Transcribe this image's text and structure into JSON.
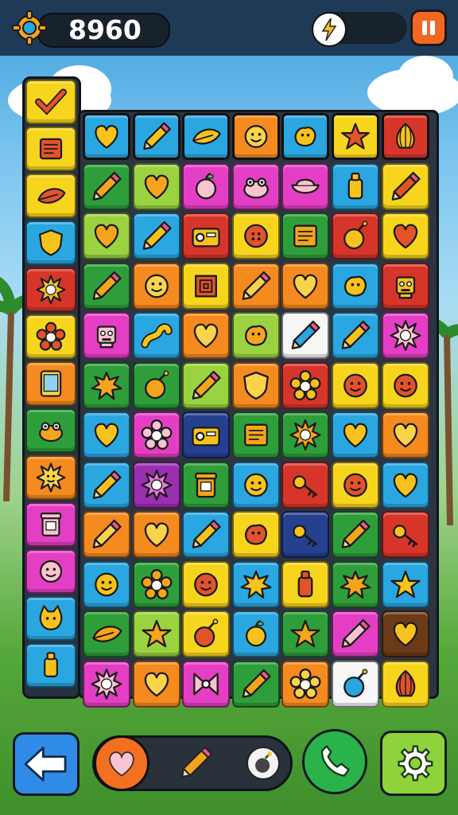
{
  "hud": {
    "score": "8960"
  },
  "colors": {
    "yellow": "#f7d51d",
    "orange": "#f58a1f",
    "green": "#2e9e3a",
    "lime": "#9ad33f",
    "blue": "#2aa6e0",
    "magenta": "#e43fc4",
    "red": "#d8352a",
    "purple": "#9b2fb0",
    "white": "#f7f7f7",
    "brown": "#6b3a18",
    "navy": "#25408f"
  },
  "side_column": {
    "tiles": [
      {
        "color": "yellow",
        "icon": "checkmark-icon"
      },
      {
        "color": "yellow",
        "icon": "note-icon"
      },
      {
        "color": "yellow",
        "icon": "leaf-icon"
      },
      {
        "color": "blue",
        "icon": "shield-icon"
      },
      {
        "color": "red",
        "icon": "sun-icon"
      },
      {
        "color": "yellow",
        "icon": "flower-icon"
      },
      {
        "color": "orange",
        "icon": "tablet-icon"
      },
      {
        "color": "green",
        "icon": "frog-icon"
      },
      {
        "color": "orange",
        "icon": "sun-face-icon"
      },
      {
        "color": "magenta",
        "icon": "jar-icon"
      },
      {
        "color": "magenta",
        "icon": "smiley-icon"
      },
      {
        "color": "blue",
        "icon": "cat-icon"
      },
      {
        "color": "blue",
        "icon": "bottle-icon"
      }
    ]
  },
  "board": {
    "featured_row": [
      {
        "color": "blue",
        "icon": "heart-icon"
      },
      {
        "color": "blue",
        "icon": "pencil-icon"
      },
      {
        "color": "blue",
        "icon": "leaf-icon"
      },
      {
        "color": "orange",
        "icon": "smiley-icon"
      },
      {
        "color": "blue",
        "icon": "blob-icon"
      },
      {
        "color": "yellow",
        "icon": "star-icon"
      },
      {
        "color": "red",
        "icon": "onion-icon"
      }
    ],
    "rows": [
      [
        {
          "color": "green",
          "icon": "pencil-icon"
        },
        {
          "color": "lime",
          "icon": "heart-icon"
        },
        {
          "color": "magenta",
          "icon": "apple-icon"
        },
        {
          "color": "magenta",
          "icon": "frog-icon"
        },
        {
          "color": "magenta",
          "icon": "bowl-icon"
        },
        {
          "color": "blue",
          "icon": "bottle-icon"
        },
        {
          "color": "yellow",
          "icon": "pencil-icon"
        }
      ],
      [
        {
          "color": "lime",
          "icon": "heart-icon"
        },
        {
          "color": "blue",
          "icon": "pencil-icon"
        },
        {
          "color": "red",
          "icon": "radio-icon"
        },
        {
          "color": "yellow",
          "icon": "button-icon"
        },
        {
          "color": "green",
          "icon": "note-icon"
        },
        {
          "color": "red",
          "icon": "bomb-icon"
        },
        {
          "color": "yellow",
          "icon": "heart-icon"
        }
      ],
      [
        {
          "color": "green",
          "icon": "pencil-icon"
        },
        {
          "color": "orange",
          "icon": "smiley-icon"
        },
        {
          "color": "yellow",
          "icon": "box-icon"
        },
        {
          "color": "orange",
          "icon": "pencil-icon"
        },
        {
          "color": "orange",
          "icon": "heart-icon"
        },
        {
          "color": "blue",
          "icon": "blob-icon"
        },
        {
          "color": "red",
          "icon": "robot-icon"
        }
      ],
      [
        {
          "color": "magenta",
          "icon": "robot-icon"
        },
        {
          "color": "blue",
          "icon": "worm-icon"
        },
        {
          "color": "orange",
          "icon": "heart-icon"
        },
        {
          "color": "lime",
          "icon": "blob-icon"
        },
        {
          "color": "white",
          "icon": "pencil-icon"
        },
        {
          "color": "blue",
          "icon": "pencil-icon"
        },
        {
          "color": "magenta",
          "icon": "sun-icon"
        }
      ],
      [
        {
          "color": "green",
          "icon": "splat-icon"
        },
        {
          "color": "green",
          "icon": "bomb-icon"
        },
        {
          "color": "lime",
          "icon": "pencil-icon"
        },
        {
          "color": "orange",
          "icon": "shield-icon"
        },
        {
          "color": "red",
          "icon": "flower-icon"
        },
        {
          "color": "yellow",
          "icon": "smiley-icon"
        },
        {
          "color": "yellow",
          "icon": "smiley-icon"
        }
      ],
      [
        {
          "color": "blue",
          "icon": "heart-icon"
        },
        {
          "color": "magenta",
          "icon": "flower-icon"
        },
        {
          "color": "navy",
          "icon": "radio-icon"
        },
        {
          "color": "green",
          "icon": "note-icon"
        },
        {
          "color": "green",
          "icon": "sun-icon"
        },
        {
          "color": "blue",
          "icon": "heart-icon"
        },
        {
          "color": "orange",
          "icon": "heart-icon"
        }
      ],
      [
        {
          "color": "blue",
          "icon": "pencil-icon"
        },
        {
          "color": "purple",
          "icon": "sun-icon"
        },
        {
          "color": "green",
          "icon": "jar-icon"
        },
        {
          "color": "blue",
          "icon": "smiley-icon"
        },
        {
          "color": "red",
          "icon": "key-icon"
        },
        {
          "color": "yellow",
          "icon": "smiley-icon"
        },
        {
          "color": "blue",
          "icon": "heart-icon"
        }
      ],
      [
        {
          "color": "orange",
          "icon": "pencil-icon"
        },
        {
          "color": "orange",
          "icon": "heart-icon"
        },
        {
          "color": "blue",
          "icon": "pencil-icon"
        },
        {
          "color": "yellow",
          "icon": "blob-icon"
        },
        {
          "color": "navy",
          "icon": "key-icon"
        },
        {
          "color": "green",
          "icon": "pencil-icon"
        },
        {
          "color": "red",
          "icon": "key-icon"
        }
      ],
      [
        {
          "color": "blue",
          "icon": "smiley-icon"
        },
        {
          "color": "green",
          "icon": "flower-icon"
        },
        {
          "color": "yellow",
          "icon": "smiley-icon"
        },
        {
          "color": "blue",
          "icon": "splat-icon"
        },
        {
          "color": "yellow",
          "icon": "bottle-icon"
        },
        {
          "color": "green",
          "icon": "splat-icon"
        },
        {
          "color": "blue",
          "icon": "star-icon"
        }
      ],
      [
        {
          "color": "green",
          "icon": "leaf-icon"
        },
        {
          "color": "lime",
          "icon": "star-icon"
        },
        {
          "color": "yellow",
          "icon": "bomb-icon"
        },
        {
          "color": "blue",
          "icon": "apple-icon"
        },
        {
          "color": "green",
          "icon": "star-icon"
        },
        {
          "color": "magenta",
          "icon": "pencil-icon"
        },
        {
          "color": "brown",
          "icon": "heart-icon"
        }
      ],
      [
        {
          "color": "magenta",
          "icon": "sun-icon"
        },
        {
          "color": "orange",
          "icon": "heart-icon"
        },
        {
          "color": "magenta",
          "icon": "bow-icon"
        },
        {
          "color": "green",
          "icon": "pencil-icon"
        },
        {
          "color": "orange",
          "icon": "flower-icon"
        },
        {
          "color": "white",
          "icon": "bomb-icon"
        },
        {
          "color": "yellow",
          "icon": "onion-icon"
        }
      ]
    ]
  },
  "bottom_bar": {
    "back_icon": "arrow-left-icon",
    "tray_items": [
      "heart-icon",
      "pencil-icon",
      "bomb-icon"
    ],
    "call_icon": "phone-icon",
    "settings_icon": "gear-icon"
  }
}
